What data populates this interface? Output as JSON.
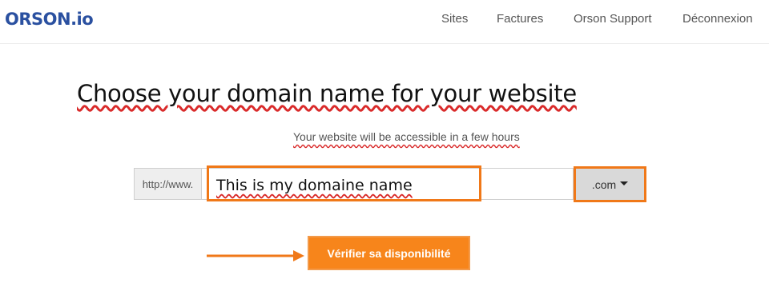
{
  "header": {
    "logo": "ORSON.io",
    "nav": [
      "Sites",
      "Factures",
      "Orson Support",
      "Déconnexion"
    ]
  },
  "main": {
    "title": "Choose your domain name for your website",
    "subtitle": "Your website will be accessible in a few hours",
    "domain_prefix": "http://www.",
    "domain_value": "This is my domaine name",
    "tld_selected": ".com",
    "check_button": "Vérifier sa disponibilité"
  },
  "colors": {
    "brand": "#2a50a0",
    "accent": "#f7851b",
    "highlight": "#f07818"
  },
  "icons": [
    "chevron-down-icon",
    "arrow-right-icon"
  ]
}
